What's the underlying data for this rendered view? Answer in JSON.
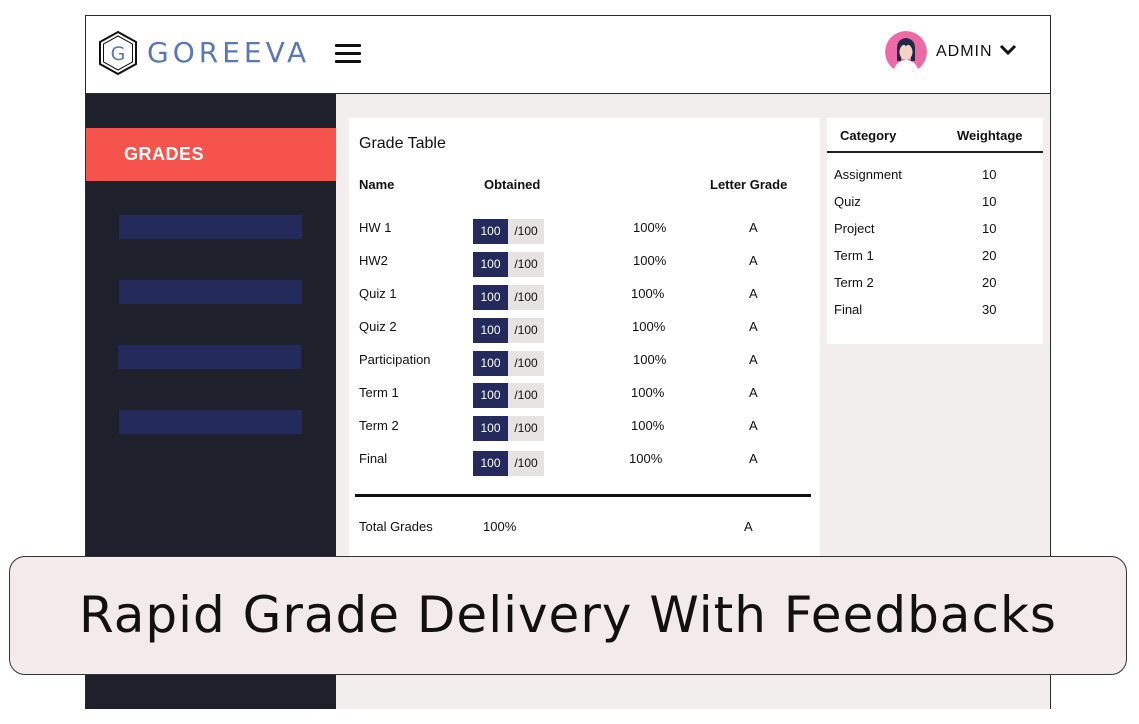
{
  "header": {
    "brand_letter": "G",
    "brand_name": "GOREEVA",
    "user_label": "ADMIN"
  },
  "sidebar": {
    "active_item": "GRADES"
  },
  "grade_table": {
    "title": "Grade Table",
    "columns": {
      "name": "Name",
      "obtained": "Obtained",
      "letter": "Letter Grade"
    },
    "rows": [
      {
        "name": "HW 1",
        "score": "100",
        "max": "/100",
        "pct": "100%",
        "letter": "A"
      },
      {
        "name": "HW2",
        "score": "100",
        "max": "/100",
        "pct": "100%",
        "letter": "A"
      },
      {
        "name": "Quiz 1",
        "score": "100",
        "max": "/100",
        "pct": "100%",
        "letter": "A"
      },
      {
        "name": "Quiz 2",
        "score": "100",
        "max": "/100",
        "pct": "100%",
        "letter": "A"
      },
      {
        "name": "Participation",
        "score": "100",
        "max": "/100",
        "pct": "100%",
        "letter": "A"
      },
      {
        "name": "Term 1",
        "score": "100",
        "max": "/100",
        "pct": "100%",
        "letter": "A"
      },
      {
        "name": "Term 2",
        "score": "100",
        "max": "/100",
        "pct": "100%",
        "letter": "A"
      },
      {
        "name": "Final",
        "score": "100",
        "max": "/100",
        "pct": "100%",
        "letter": "A"
      }
    ],
    "total": {
      "label": "Total Grades",
      "pct": "100%",
      "letter": "A"
    }
  },
  "weightage": {
    "columns": {
      "category": "Category",
      "weight": "Weightage"
    },
    "rows": [
      {
        "category": "Assignment",
        "weight": "10"
      },
      {
        "category": "Quiz",
        "weight": "10"
      },
      {
        "category": "Project",
        "weight": "10"
      },
      {
        "category": "Term 1",
        "weight": "20"
      },
      {
        "category": "Term 2",
        "weight": "20"
      },
      {
        "category": "Final",
        "weight": "30"
      }
    ]
  },
  "banner": {
    "text": "Rapid Grade Delivery With Feedbacks"
  },
  "colors": {
    "accent": "#f7534d",
    "sidebar": "#1e212b",
    "navy": "#242a5b",
    "logo": "#5a78b8"
  }
}
